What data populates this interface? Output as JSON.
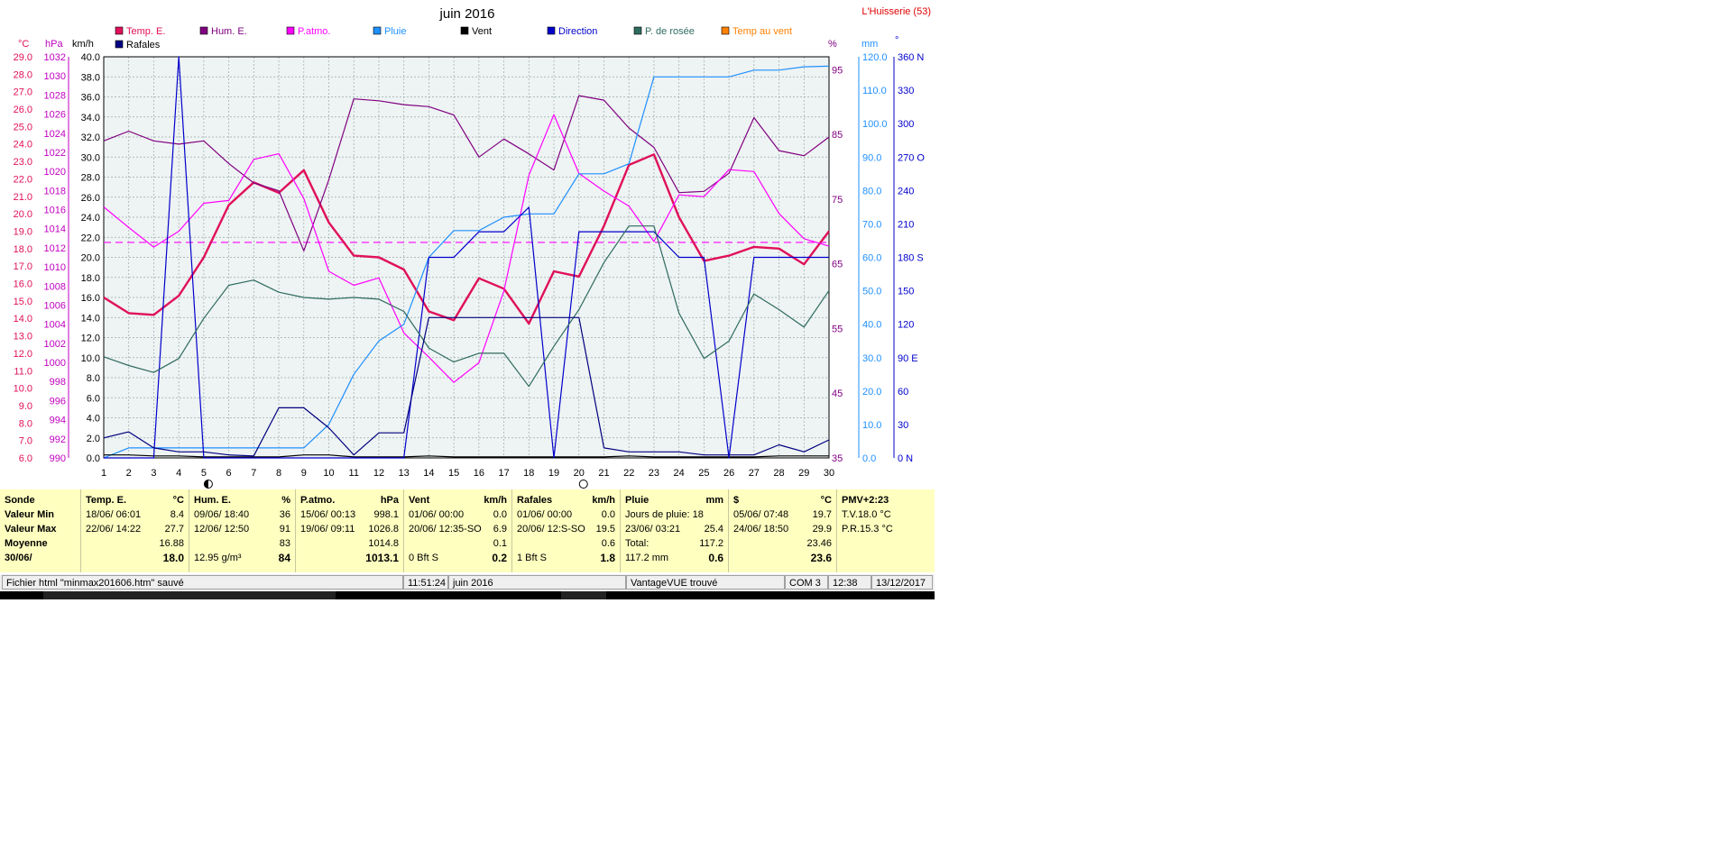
{
  "chart_data": {
    "type": "line",
    "title": "juin 2016",
    "station": "L'Huisserie (53)",
    "x": [
      1,
      2,
      3,
      4,
      5,
      6,
      7,
      8,
      9,
      10,
      11,
      12,
      13,
      14,
      15,
      16,
      17,
      18,
      19,
      20,
      21,
      22,
      23,
      24,
      25,
      26,
      27,
      28,
      29,
      30
    ],
    "legend": [
      {
        "name": "Temp. E.",
        "color": "#e0105a"
      },
      {
        "name": "Hum. E.",
        "color": "#800080"
      },
      {
        "name": "P.atmo.",
        "color": "#ff00ff"
      },
      {
        "name": "Pluie",
        "color": "#1e90ff"
      },
      {
        "name": "Vent",
        "color": "#000000"
      },
      {
        "name": "Direction",
        "color": "#0000cc"
      },
      {
        "name": "P. de rosée",
        "color": "#2e6b5e"
      },
      {
        "name": "Temp au vent",
        "color": "#ff8000"
      },
      {
        "name": "Rafales",
        "color": "#000080"
      }
    ],
    "axes_left": {
      "temp_unit": "°C",
      "temp_ticks": [
        "29.0",
        "28.0",
        "27.0",
        "26.0",
        "25.0",
        "24.0",
        "23.0",
        "22.0",
        "21.0",
        "20.0",
        "19.0",
        "18.0",
        "17.0",
        "16.0",
        "15.0",
        "14.0",
        "13.0",
        "12.0",
        "11.0",
        "10.0",
        "9.0",
        "8.0",
        "7.0",
        "6.0"
      ],
      "pressure_unit": "hPa",
      "pressure_ticks": [
        "1032",
        "1030",
        "1028",
        "1026",
        "1024",
        "1022",
        "1020",
        "1018",
        "1016",
        "1014",
        "1012",
        "1010",
        "1008",
        "1006",
        "1004",
        "1002",
        "1000",
        "998",
        "996",
        "994",
        "992",
        "990"
      ],
      "wind_unit": "km/h",
      "wind_ticks": [
        "40.0",
        "38.0",
        "36.0",
        "34.0",
        "32.0",
        "30.0",
        "28.0",
        "26.0",
        "24.0",
        "22.0",
        "20.0",
        "18.0",
        "16.0",
        "14.0",
        "12.0",
        "10.0",
        "8.0",
        "6.0",
        "4.0",
        "2.0",
        "0.0"
      ]
    },
    "axes_right": {
      "hum_unit": "%",
      "hum_ticks": [
        "95",
        "85",
        "75",
        "65",
        "55",
        "45",
        "35"
      ],
      "rain_unit": "mm",
      "rain_ticks": [
        "120.0",
        "110.0",
        "100.0",
        "90.0",
        "80.0",
        "70.0",
        "60.0",
        "50.0",
        "40.0",
        "30.0",
        "20.0",
        "10.0",
        "0.0"
      ],
      "dir_unit": "°",
      "dir_ticks": [
        "360 N",
        "330",
        "300",
        "270 O",
        "240",
        "210",
        "180 S",
        "150",
        "120",
        "90  E",
        "60",
        "30",
        "0    N"
      ]
    },
    "temp_range": [
      6,
      29
    ],
    "hum_range": [
      35,
      97
    ],
    "pressure_range": [
      990,
      1033
    ],
    "wind_range": [
      0,
      40
    ],
    "rain_range": [
      0,
      120
    ],
    "dir_range": [
      0,
      360
    ],
    "series": [
      {
        "name": "Temp. E.",
        "values": [
          15.2,
          14.3,
          14.2,
          15.3,
          17.5,
          20.5,
          21.8,
          21.2,
          22.5,
          19.5,
          17.6,
          17.5,
          16.8,
          14.4,
          13.9,
          16.3,
          15.7,
          13.7,
          16.7,
          16.4,
          19.3,
          22.8,
          23.4,
          19.8,
          17.3,
          17.6,
          18.1,
          18.0,
          17.1,
          19.0
        ]
      },
      {
        "name": "Hum. E.",
        "values": [
          84,
          85.5,
          84,
          83.5,
          84,
          80.5,
          77.5,
          76.3,
          67,
          78,
          90.5,
          90.2,
          89.6,
          89.3,
          88,
          81.5,
          84.3,
          82,
          79.5,
          91,
          90.3,
          86,
          83,
          76,
          76.2,
          79,
          87.6,
          82.5,
          81.7,
          84.6
        ]
      },
      {
        "name": "P.atmo.",
        "values": [
          1016.9,
          1014.7,
          1012.6,
          1014.3,
          1017.3,
          1017.6,
          1022,
          1022.6,
          1017.8,
          1010,
          1008.5,
          1009.3,
          1003.4,
          1000.8,
          998.1,
          1000.2,
          1007.9,
          1020.3,
          1026.8,
          1020.5,
          1018.6,
          1017,
          1013.2,
          1018.2,
          1018,
          1020.9,
          1020.7,
          1016.2,
          1013.5,
          1012.7
        ]
      },
      {
        "name": "Pluie",
        "values": [
          0,
          3,
          3,
          3,
          3,
          3,
          3,
          3,
          3,
          10,
          25,
          35,
          40,
          60,
          68,
          68,
          72,
          73,
          73,
          85,
          85,
          88,
          114,
          114,
          114,
          114,
          116,
          116,
          117,
          117.2
        ]
      },
      {
        "name": "Vent",
        "values": [
          0.3,
          0.3,
          0.2,
          0.2,
          0.1,
          0.1,
          0.1,
          0.1,
          0.3,
          0.3,
          0.1,
          0.1,
          0.1,
          0.2,
          0.1,
          0.1,
          0.1,
          0.1,
          0.1,
          0.1,
          0.1,
          0.2,
          0.1,
          0.1,
          0.1,
          0.1,
          0.1,
          0.2,
          0.2,
          0.2
        ]
      },
      {
        "name": "Direction",
        "values": [
          0,
          0,
          0,
          360,
          0,
          0,
          0,
          0,
          0,
          0,
          0,
          0,
          0,
          180,
          180,
          203,
          203,
          225,
          0,
          203,
          203,
          203,
          203,
          180,
          180,
          0,
          180,
          180,
          180,
          180
        ]
      },
      {
        "name": "P. de rosée",
        "values": [
          11.8,
          11.3,
          10.9,
          11.7,
          14,
          15.9,
          16.2,
          15.5,
          15.2,
          15.1,
          15.2,
          15.1,
          14.4,
          12.3,
          11.5,
          12,
          12,
          10.1,
          12.4,
          14.5,
          17.2,
          19.3,
          19.3,
          14.3,
          11.7,
          12.7,
          15.4,
          14.5,
          13.5,
          15.6
        ]
      },
      {
        "name": "Rafales",
        "values": [
          2.0,
          2.6,
          1.0,
          0.6,
          0.6,
          0.3,
          0.2,
          5.0,
          5.0,
          3.0,
          0.3,
          2.5,
          2.5,
          14,
          14,
          14,
          14,
          14,
          14,
          14,
          1.0,
          0.6,
          0.6,
          0.6,
          0.3,
          0.3,
          0.3,
          1.3,
          0.6,
          1.8
        ]
      }
    ],
    "pressure_mean": 1013.1,
    "moon_days": [
      {
        "day": 5,
        "phase": "half"
      },
      {
        "day": 20,
        "phase": "full"
      }
    ]
  },
  "stats": {
    "sonde": {
      "label": "Sonde",
      "min": "Valeur Min",
      "max": "Valeur Max",
      "moy": "Moyenne",
      "date": "30/06/"
    },
    "temp": {
      "title": "Temp. E.",
      "unit": "°C",
      "min_date": "18/06/  06:01",
      "min": "8.4",
      "max_date": "22/06/  14:22",
      "max": "27.7",
      "moy": "16.88",
      "cur": "18.0"
    },
    "hum": {
      "title": "Hum. E.",
      "unit": "%",
      "min_date": "09/06/  18:40",
      "min": "36",
      "max_date": "12/06/  12:50",
      "max": "91",
      "moy": "83",
      "abs": "12.95 g/m³",
      "cur": "84"
    },
    "patmo": {
      "title": "P.atmo.",
      "unit": "hPa",
      "min_date": "15/06/  00:13",
      "min": "998.1",
      "max_date": "19/06/  09:11",
      "max": "1026.8",
      "moy": "1014.8",
      "cur": "1013.1"
    },
    "vent": {
      "title": "Vent",
      "unit": "km/h",
      "min_date": "01/06/  00:00",
      "min": "0.0",
      "max_date": "20/06/  12:35-SO",
      "max": "6.9",
      "moy": "0.1",
      "bft": "0 Bft  S",
      "cur": "0.2"
    },
    "rafales": {
      "title": "Rafales",
      "unit": "km/h",
      "min_date": "01/06/  00:00",
      "min": "0.0",
      "max_date": "20/06/  12:S-SO",
      "max": "19.5",
      "moy": "0.6",
      "bft": "1 Bft  S",
      "cur": "1.8"
    },
    "pluie": {
      "title": "Pluie",
      "unit": "mm",
      "jours": "Jours de pluie: 18",
      "max_date": "23/06/  03:21",
      "max": "25.4",
      "total_label": "Total:",
      "total": "117.2",
      "cur_label": "117.2 mm",
      "cur": "0.6"
    },
    "s": {
      "title": "$",
      "unit": "°C",
      "min_date": "05/06/  07:48",
      "min": "19.7",
      "max_date": "24/06/  18:50",
      "max": "29.9",
      "moy": "23.46",
      "cur": "23.6"
    },
    "pmv": {
      "title": "PMV+2:23",
      "tv": "T.V.18.0 °C",
      "pr": "P.R.15.3 °C"
    }
  },
  "statusbar": {
    "file": "Fichier html  \"minmax201606.htm\"  sauvé",
    "time": "11:51:24",
    "month": "juin 2016",
    "device": "VantageVUE trouvé",
    "port": "COM 3",
    "clock": "12:38",
    "date": "13/12/2017"
  }
}
